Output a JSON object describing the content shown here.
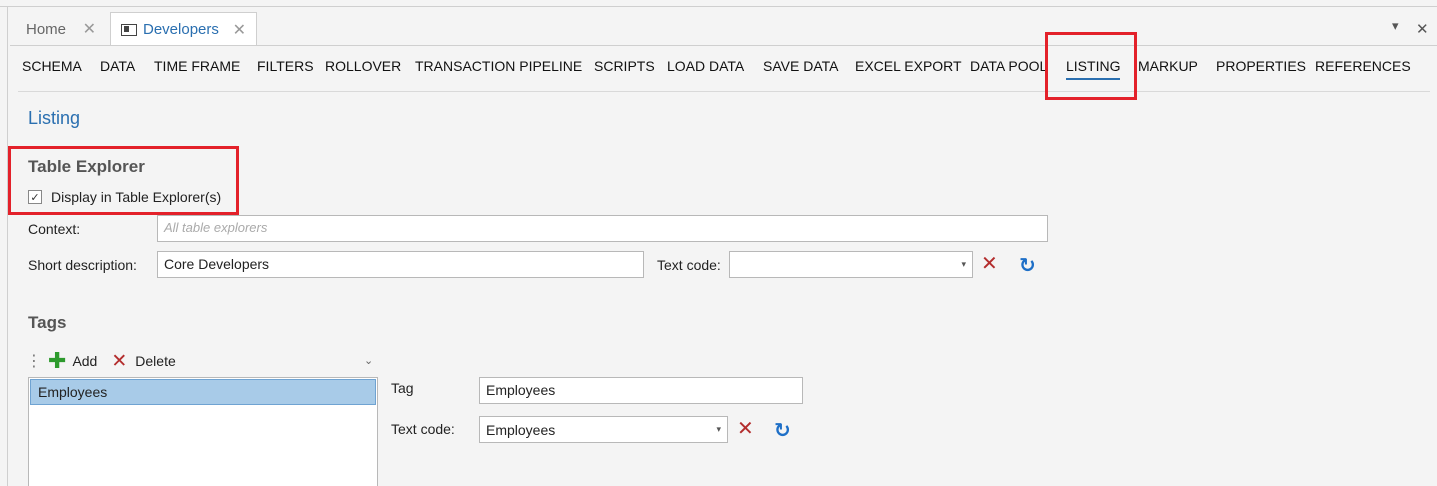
{
  "doc_tabs": [
    {
      "label": "Home",
      "close": "✕"
    },
    {
      "label": "Developers",
      "close": "✕"
    }
  ],
  "window_controls": {
    "dropdown": "▾",
    "close": "✕"
  },
  "nav": {
    "items": [
      "SCHEMA",
      "DATA",
      "TIME FRAME",
      "FILTERS",
      "ROLLOVER",
      "TRANSACTION PIPELINE",
      "SCRIPTS",
      "LOAD DATA",
      "SAVE DATA",
      "EXCEL EXPORT",
      "DATA POOL",
      "LISTING",
      "MARKUP",
      "PROPERTIES",
      "REFERENCES"
    ],
    "active": "LISTING"
  },
  "page_title": "Listing",
  "table_explorer": {
    "heading": "Table Explorer",
    "display_checkbox_label": "Display in Table Explorer(s)",
    "display_checked": true,
    "check_glyph": "✓"
  },
  "context": {
    "label": "Context:",
    "value": "",
    "placeholder": "All table explorers"
  },
  "short_description": {
    "label": "Short description:",
    "value": "Core Developers"
  },
  "text_code": {
    "label": "Text code:",
    "value": ""
  },
  "tags": {
    "heading": "Tags",
    "add_label": "Add",
    "delete_label": "Delete",
    "items": [
      "Employees"
    ],
    "selected": "Employees",
    "tag_label": "Tag",
    "tag_value": "Employees",
    "text_code_label": "Text code:",
    "text_code_value": "Employees"
  },
  "icons": {
    "clear": "✕",
    "refresh": "↻",
    "plus": "✚",
    "grip": "⋮",
    "dropdown": "▾",
    "chooser": "⌄"
  },
  "colors": {
    "accent": "#2a6fb0",
    "highlight_box": "#e3212a",
    "selection": "#a8cbe8",
    "delete": "#b32d2d",
    "refresh": "#1e6fc7",
    "add": "#2d9a2d"
  }
}
